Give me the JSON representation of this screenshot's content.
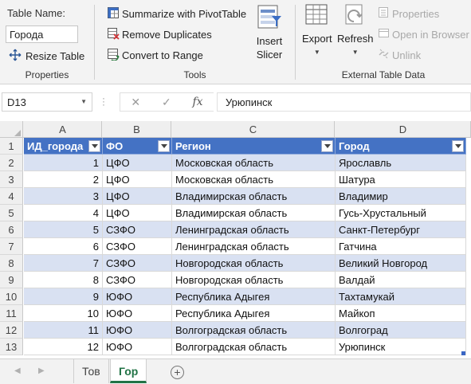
{
  "ribbon": {
    "properties": {
      "table_name_label": "Table Name:",
      "table_name_value": "Города",
      "resize_label": "Resize Table",
      "group_label": "Properties"
    },
    "tools": {
      "summarize_label": "Summarize with PivotTable",
      "remove_duplicates_label": "Remove Duplicates",
      "convert_label": "Convert to Range",
      "insert_slicer_line1": "Insert",
      "insert_slicer_line2": "Slicer",
      "group_label": "Tools"
    },
    "external": {
      "export_label": "Export",
      "refresh_label": "Refresh",
      "properties_label": "Properties",
      "open_browser_label": "Open in Browser",
      "unlink_label": "Unlink",
      "group_label": "External Table Data"
    }
  },
  "formula_bar": {
    "name_box": "D13",
    "formula": "Урюпинск",
    "fx_label": "fx"
  },
  "grid": {
    "columns": [
      "A",
      "B",
      "C",
      "D"
    ],
    "header_row_number": "1",
    "headers": [
      "ИД_города",
      "ФО",
      "Регион",
      "Город"
    ],
    "rows": [
      {
        "n": "2",
        "id": "1",
        "fo": "ЦФО",
        "region": "Московская область",
        "city": "Ярославль"
      },
      {
        "n": "3",
        "id": "2",
        "fo": "ЦФО",
        "region": "Московская область",
        "city": "Шатура"
      },
      {
        "n": "4",
        "id": "3",
        "fo": "ЦФО",
        "region": "Владимирская область",
        "city": "Владимир"
      },
      {
        "n": "5",
        "id": "4",
        "fo": "ЦФО",
        "region": "Владимирская область",
        "city": "Гусь-Хрустальный"
      },
      {
        "n": "6",
        "id": "5",
        "fo": "СЗФО",
        "region": "Ленинградская область",
        "city": "Санкт-Петербург"
      },
      {
        "n": "7",
        "id": "6",
        "fo": "СЗФО",
        "region": "Ленинградская область",
        "city": "Гатчина"
      },
      {
        "n": "8",
        "id": "7",
        "fo": "СЗФО",
        "region": "Новгородская область",
        "city": "Великий Новгород"
      },
      {
        "n": "9",
        "id": "8",
        "fo": "СЗФО",
        "region": "Новгородская область",
        "city": "Валдай"
      },
      {
        "n": "10",
        "id": "9",
        "fo": "ЮФО",
        "region": "Республика Адыгея",
        "city": "Тахтамукай"
      },
      {
        "n": "11",
        "id": "10",
        "fo": "ЮФО",
        "region": "Республика Адыгея",
        "city": "Майкоп"
      },
      {
        "n": "12",
        "id": "11",
        "fo": "ЮФО",
        "region": "Волгоградская область",
        "city": "Волгоград"
      },
      {
        "n": "13",
        "id": "12",
        "fo": "ЮФО",
        "region": "Волгоградская область",
        "city": "Урюпинск"
      }
    ]
  },
  "sheets": {
    "tabs": [
      "Тов",
      "Гор"
    ],
    "active": "Гор"
  },
  "colors": {
    "header_fill": "#4472c4",
    "band_fill": "#d9e1f2",
    "active_tab": "#217346"
  }
}
